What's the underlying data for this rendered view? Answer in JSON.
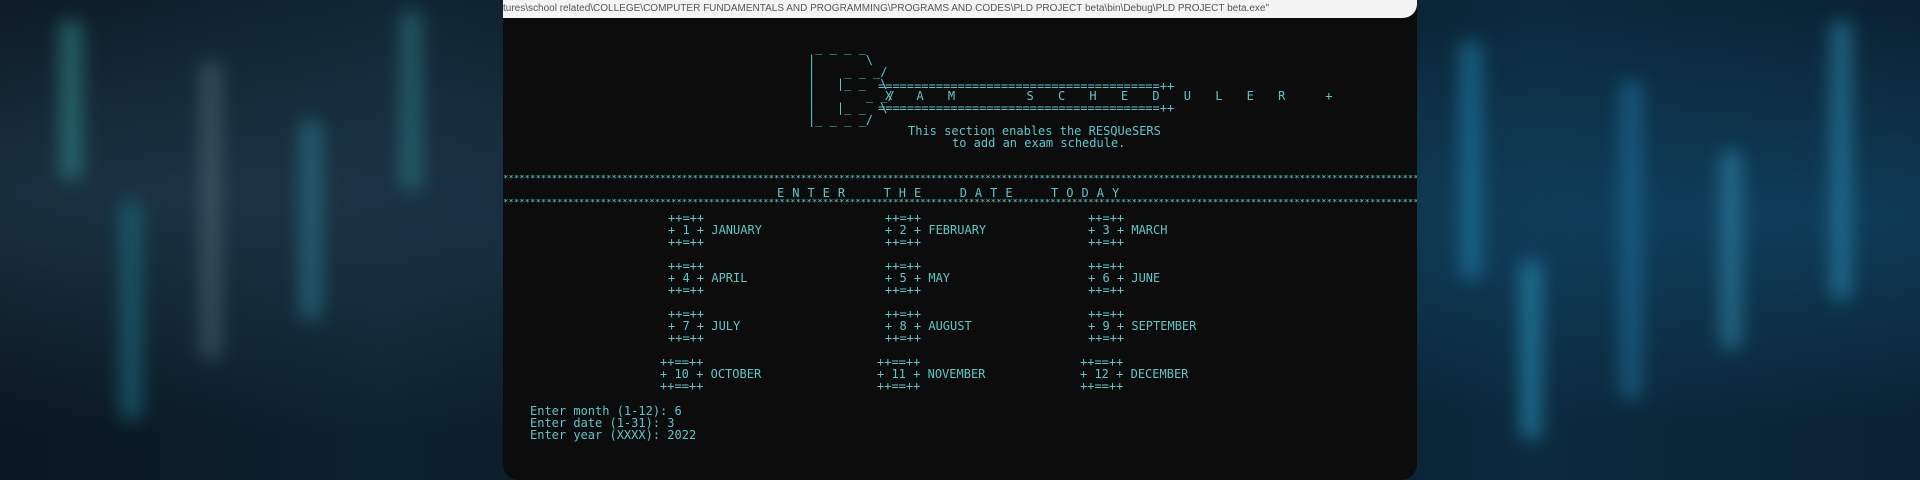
{
  "window": {
    "title": "tures\\school related\\COLLEGE\\COMPUTER FUNDAMENTALS AND PROGRAMMING\\PROGRAMS AND CODES\\PLD PROJECT beta\\bin\\Debug\\PLD PROJECT beta.exe\""
  },
  "header": {
    "ascii_logo": " _ _ _ _\n|       \\\n|    _ _ _/\n|   |_ _  \\\n|       _ _/\n|   |_ _  \\\n|_ _ _ _/",
    "rule_top": "=======================================++",
    "title": "X A M    S C H E D U L E R  +",
    "rule_bottom": "=======================================++",
    "desc_line1": "This section enables the RESQUeSERS",
    "desc_line2": "to add an exam schedule."
  },
  "banner": {
    "stars": "******************************************************************************************************************************************************************************************************************",
    "label": "ENTER  THE  DATE  TODAY"
  },
  "months": [
    {
      "top": "++=++",
      "mid": "+ 1 +",
      "bot": "++=++",
      "name": "JANUARY"
    },
    {
      "top": "++=++",
      "mid": "+ 2 +",
      "bot": "++=++",
      "name": "FEBRUARY"
    },
    {
      "top": "++=++",
      "mid": "+ 3 +",
      "bot": "++=++",
      "name": "MARCH"
    },
    {
      "top": "++=++",
      "mid": "+ 4 +",
      "bot": "++=++",
      "name": "APRIL"
    },
    {
      "top": "++=++",
      "mid": "+ 5 +",
      "bot": "++=++",
      "name": "MAY"
    },
    {
      "top": "++=++",
      "mid": "+ 6 +",
      "bot": "++=++",
      "name": "JUNE"
    },
    {
      "top": "++=++",
      "mid": "+ 7 +",
      "bot": "++=++",
      "name": "JULY"
    },
    {
      "top": "++=++",
      "mid": "+ 8 +",
      "bot": "++=++",
      "name": "AUGUST"
    },
    {
      "top": "++=++",
      "mid": "+ 9 +",
      "bot": "++=++",
      "name": "SEPTEMBER"
    },
    {
      "top": "++==++",
      "mid": "+ 10 +",
      "bot": "++==++",
      "name": "OCTOBER"
    },
    {
      "top": "++==++",
      "mid": "+ 11 +",
      "bot": "++==++",
      "name": "NOVEMBER"
    },
    {
      "top": "++==++",
      "mid": "+ 12 +",
      "bot": "++==++",
      "name": "DECEMBER"
    }
  ],
  "prompts": {
    "month": "Enter month (1-12): 6",
    "date": "Enter date (1-31): 3",
    "year": "Enter year (XXXX): 2022"
  },
  "colors": {
    "console_text": "#5fc7c7",
    "console_bg": "#0c0c0c"
  }
}
